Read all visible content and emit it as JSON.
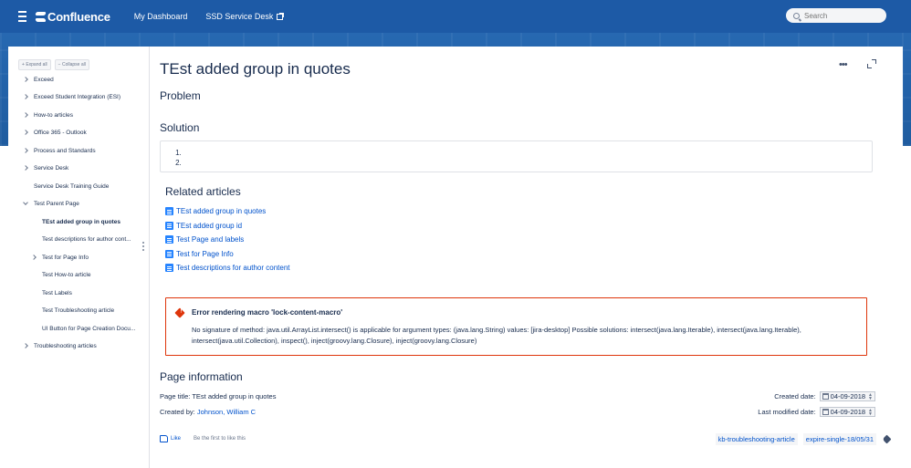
{
  "header": {
    "logo_text": "Confluence",
    "nav": [
      {
        "label": "My Dashboard"
      },
      {
        "label": "SSD Service Desk"
      }
    ],
    "search_placeholder": "Search"
  },
  "sidebar": {
    "expand_all": "Expand all",
    "collapse_all": "Collapse all",
    "items": [
      {
        "label": "Exceed"
      },
      {
        "label": "Exceed Student Integration (ESI)"
      },
      {
        "label": "How-to articles"
      },
      {
        "label": "Office 365 - Outlook"
      },
      {
        "label": "Process and Standards"
      },
      {
        "label": "Service Desk"
      },
      {
        "label": "Service Desk Training Guide"
      },
      {
        "label": "Test Parent Page"
      },
      {
        "label": "TEst added group in quotes"
      },
      {
        "label": "Test descriptions for author cont..."
      },
      {
        "label": "Test for Page Info"
      },
      {
        "label": "Test How-to article"
      },
      {
        "label": "Test Labels"
      },
      {
        "label": "Test Troubleshooting article"
      },
      {
        "label": "UI Button for Page Creation Docu..."
      },
      {
        "label": "Troubleshooting articles"
      }
    ]
  },
  "page": {
    "title": "TEst added group in quotes",
    "more_label": "•••",
    "problem_heading": "Problem",
    "solution_heading": "Solution",
    "solution_items": [
      "",
      ""
    ],
    "related_heading": "Related articles",
    "related": [
      {
        "label": "TEst added group in quotes"
      },
      {
        "label": "TEst added group id"
      },
      {
        "label": "Test Page and labels"
      },
      {
        "label": "Test for Page Info"
      },
      {
        "label": "Test descriptions for author content"
      }
    ],
    "error": {
      "title": "Error rendering macro 'lock-content-macro'",
      "message": "No signature of method: java.util.ArrayList.intersect() is applicable for argument types: (java.lang.String) values: [jira-desktop] Possible solutions: intersect(java.lang.Iterable), intersect(java.lang.Iterable), intersect(java.util.Collection), inspect(), inject(groovy.lang.Closure), inject(groovy.lang.Closure)"
    },
    "page_info": {
      "heading": "Page information",
      "title_label": "Page title:",
      "title_value": "TEst added group in quotes",
      "created_by_label": "Created by:",
      "created_by_value": "Johnson, William C",
      "created_date_label": "Created date:",
      "created_date_value": "04-09-2018",
      "modified_date_label": "Last modified date:",
      "modified_date_value": "04-09-2018"
    },
    "like_label": "Like",
    "like_hint": "Be the first to like this",
    "labels": [
      "kb-troubleshooting-article",
      "expire-single-18/05/31"
    ]
  },
  "colors": {
    "header_blue": "#1d5aa6",
    "link": "#0052cc",
    "error_border": "#de350b"
  }
}
